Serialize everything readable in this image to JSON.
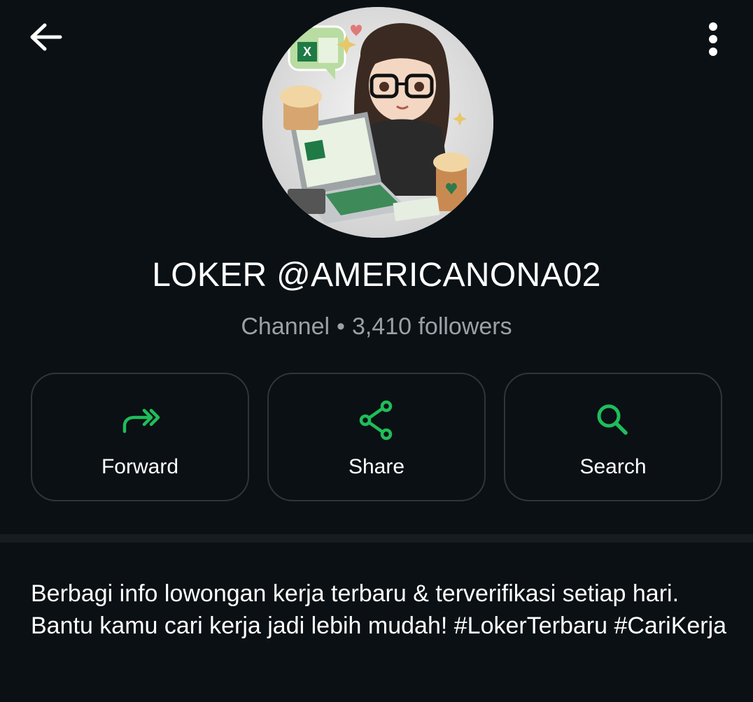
{
  "header": {
    "back_icon": "arrow-left-icon",
    "menu_icon": "more-vertical-icon"
  },
  "profile": {
    "avatar_alt": "Channel avatar illustration",
    "name": "LOKER @AMERICANONA02",
    "type": "Channel",
    "separator": "•",
    "followers": "3,410 followers"
  },
  "actions": [
    {
      "label": "Forward",
      "icon": "forward-icon"
    },
    {
      "label": "Share",
      "icon": "share-icon"
    },
    {
      "label": "Search",
      "icon": "search-icon"
    }
  ],
  "description": {
    "text": "Berbagi info lowongan kerja terbaru & terverifikasi setiap hari. Bantu kamu cari kerja jadi lebih mudah! #LokerTerbaru #CariKerja"
  },
  "colors": {
    "background": "#0b1014",
    "accent": "#1fbd5a",
    "muted_text": "#9aa1a7",
    "card_border": "#2e353b"
  }
}
